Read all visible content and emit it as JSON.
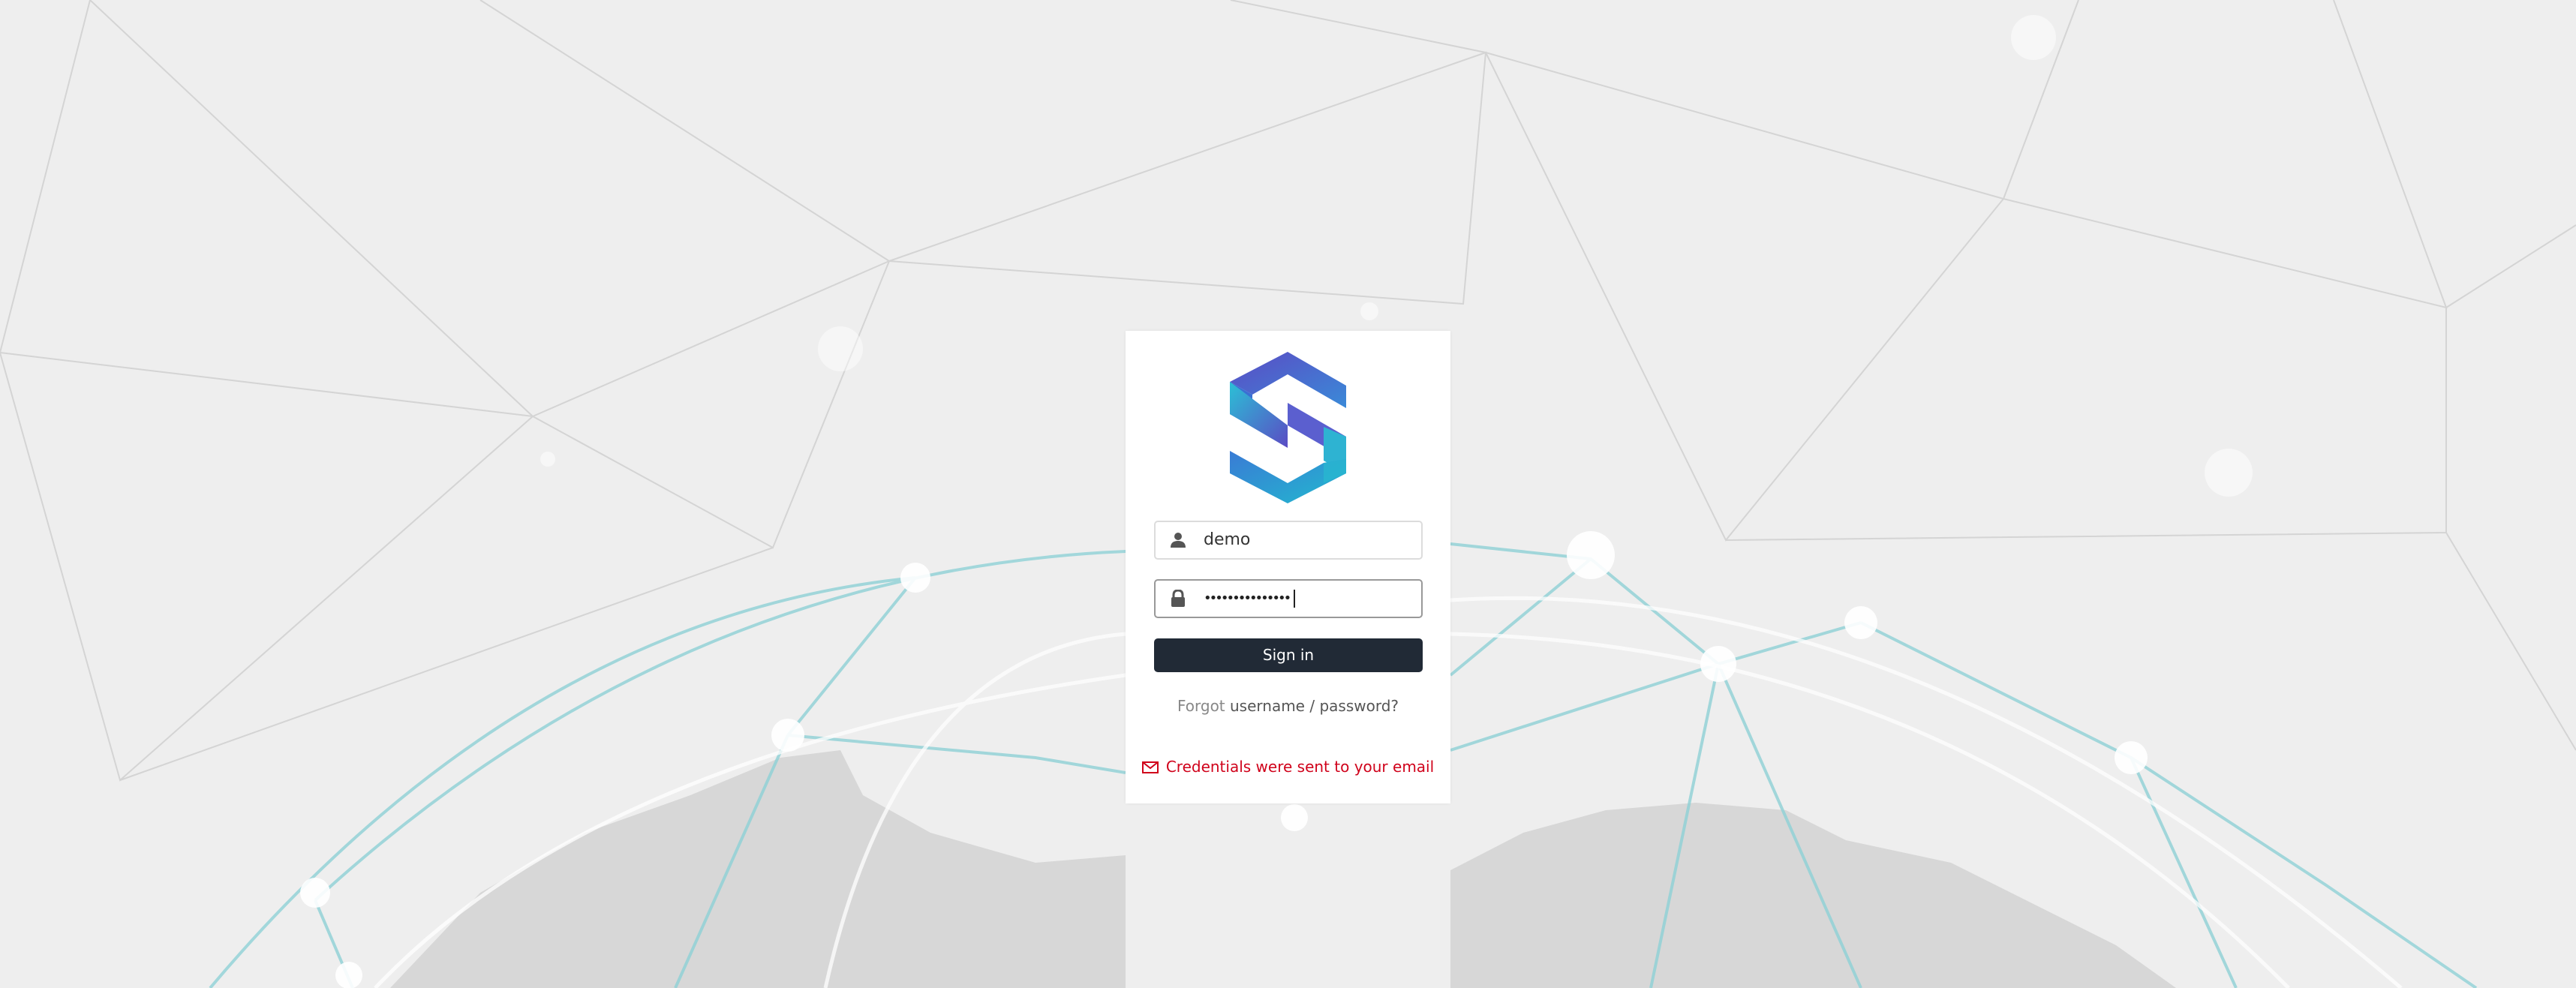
{
  "login": {
    "username_value": "demo",
    "password_mask": "•••••••••••••••",
    "signin_label": "Sign in",
    "forgot_prefix": "Forgot",
    "forgot_link": "username / password?",
    "message": "Credentials were sent to your email"
  },
  "icons": {
    "username": "user-icon",
    "password": "lock-icon",
    "message": "mail-icon",
    "logo": "s-logo"
  },
  "colors": {
    "background": "#eeeeee",
    "card": "#ffffff",
    "button": "#212a36",
    "error": "#d0021b",
    "logo_blue": "#3a7bd5",
    "logo_cyan": "#22b8cf",
    "logo_purple": "#6a5acd",
    "network_line": "#8ed1d6"
  }
}
